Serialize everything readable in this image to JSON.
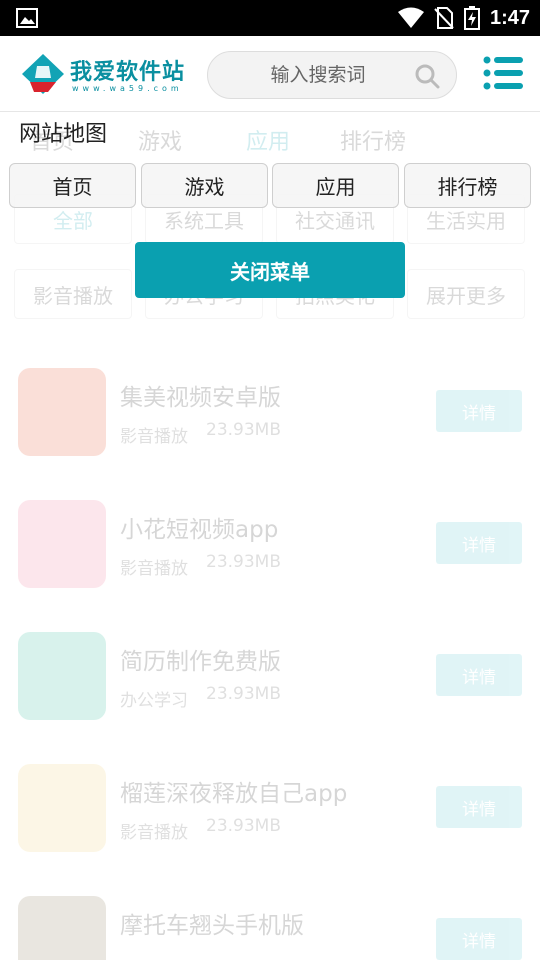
{
  "status_bar": {
    "time": "1:47",
    "icons": [
      "gallery-icon",
      "wifi-icon",
      "no-sim-icon",
      "battery-charging-icon"
    ]
  },
  "header": {
    "brand": "我爱软件站",
    "url": "www.wa59.com",
    "search_placeholder": "输入搜索词"
  },
  "sitemap": {
    "title": "网站地图",
    "nav": [
      "首页",
      "游戏",
      "应用",
      "排行榜"
    ],
    "close_label": "关闭菜单"
  },
  "background": {
    "tabs": [
      "首页",
      "游戏",
      "应用",
      "排行榜"
    ],
    "active_tab": "应用",
    "categories": [
      "全部",
      "系统工具",
      "社交通讯",
      "生活实用",
      "影音播放",
      "办公学习",
      "拍照美化",
      "展开更多"
    ],
    "apps": [
      {
        "name": "集美视频安卓版",
        "category": "影音播放",
        "size": "23.93MB",
        "button": "详情"
      },
      {
        "name": "小花短视频app",
        "category": "影音播放",
        "size": "23.93MB",
        "button": "详情"
      },
      {
        "name": "简历制作免费版",
        "category": "办公学习",
        "size": "23.93MB",
        "button": "详情"
      },
      {
        "name": "榴莲深夜释放自己app",
        "category": "影音播放",
        "size": "23.93MB",
        "button": "详情"
      },
      {
        "name": "摩托车翘头手机版",
        "category": "",
        "size": "",
        "button": "详情"
      }
    ]
  },
  "colors": {
    "accent": "#0aa0b0",
    "status_bar": "#000000"
  }
}
